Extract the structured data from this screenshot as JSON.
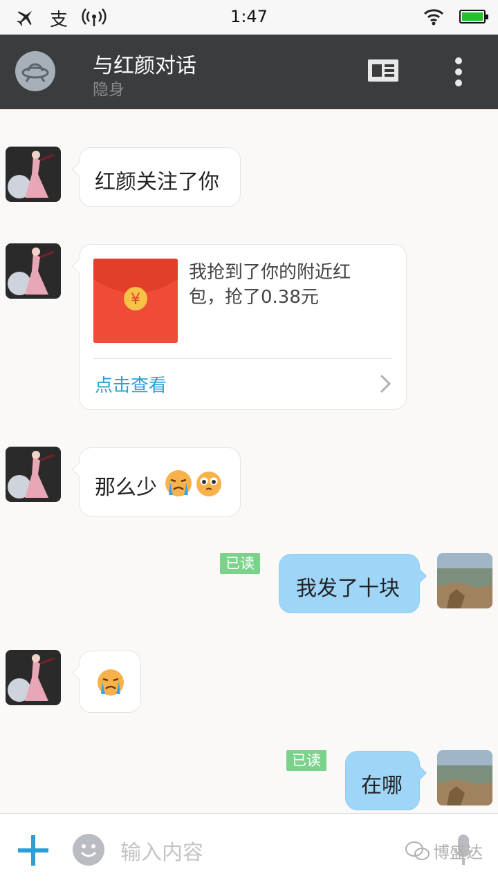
{
  "status_bar": {
    "time": "1:47",
    "alipay_glyph": "支"
  },
  "header": {
    "title": "与红颜对话",
    "subtitle": "隐身",
    "icons": [
      "ufo-avatar-icon",
      "profile-card-icon",
      "more-vertical-icon"
    ]
  },
  "messages": [
    {
      "side": "incoming",
      "type": "text",
      "text": "红颜关注了你"
    },
    {
      "side": "incoming",
      "type": "red_packet",
      "text": "我抢到了你的附近红包，抢了0.38元",
      "line1": "我抢到了你的附近红",
      "line2": "包，抢了0.38元",
      "action": "点击查看",
      "coin_glyph": "¥"
    },
    {
      "side": "incoming",
      "type": "text",
      "text": "那么少",
      "emojis": [
        "crying-emoji",
        "pleading-emoji"
      ]
    },
    {
      "side": "outgoing",
      "type": "text",
      "text": "我发了十块",
      "read_label": "已读"
    },
    {
      "side": "incoming",
      "type": "emoji",
      "emojis": [
        "crying-emoji"
      ]
    },
    {
      "side": "outgoing",
      "type": "text",
      "text": "在哪",
      "read_label": "已读"
    }
  ],
  "input_bar": {
    "placeholder": "输入内容",
    "watermark": "博盛达"
  },
  "colors": {
    "header_bg": "#3b3c3d",
    "outgoing_bubble": "#9fd6f8",
    "read_badge": "#7bd28a",
    "link": "#2a9fd8",
    "red_packet": "#f04b36",
    "plus_icon": "#2a9fd8"
  }
}
